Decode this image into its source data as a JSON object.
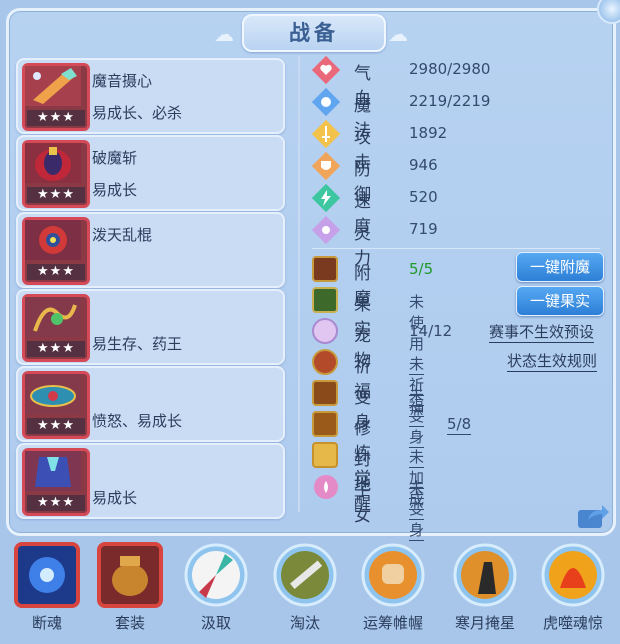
{
  "title": "战备",
  "equipment": [
    {
      "name": "魔音摄心",
      "tags": "易成长、必杀",
      "stars": "★★★"
    },
    {
      "name": "破魔斩",
      "tags": "易成长",
      "stars": "★★★"
    },
    {
      "name": "泼天乱棍",
      "tags": "",
      "stars": "★★★"
    },
    {
      "name": "",
      "tags": "易生存、药王",
      "stars": "★★★"
    },
    {
      "name": "",
      "tags": "愤怒、易成长",
      "stars": "★★★"
    },
    {
      "name": "",
      "tags": "易成长",
      "stars": "★★★"
    }
  ],
  "stats": [
    {
      "label": "气血",
      "value": "2980/2980",
      "icon": "heart-icon"
    },
    {
      "label": "魔法",
      "value": "2219/2219",
      "icon": "mana-icon"
    },
    {
      "label": "攻击",
      "value": "1892",
      "icon": "attack-icon"
    },
    {
      "label": "防御",
      "value": "946",
      "icon": "defense-icon"
    },
    {
      "label": "速度",
      "value": "520",
      "icon": "speed-icon"
    },
    {
      "label": "灵力",
      "value": "719",
      "icon": "spirit-icon"
    }
  ],
  "attributes": [
    {
      "label": "附魔",
      "value": "5/5"
    },
    {
      "label": "果实",
      "value": "未使用"
    },
    {
      "label": "宠物",
      "value": "14/12"
    },
    {
      "label": "祈福",
      "value": "未祈福"
    },
    {
      "label": "变身",
      "value": "未变身"
    },
    {
      "label": "修炼觉醒",
      "value": "5/8"
    },
    {
      "label": "封地",
      "value": "未加成"
    },
    {
      "label": "子女",
      "value": "未变身"
    }
  ],
  "buttons": {
    "enchant_all": "一键附魔",
    "fruit_all": "一键果实"
  },
  "links": {
    "preset": "赛事不生效预设",
    "rules": "状态生效规则"
  },
  "bottom_bar": [
    {
      "label": "断魂"
    },
    {
      "label": "套装"
    },
    {
      "label": "汲取"
    },
    {
      "label": "淘汰"
    },
    {
      "label": "运筹帷幄"
    },
    {
      "label": "寒月掩星"
    },
    {
      "label": "虎噬魂惊"
    }
  ]
}
